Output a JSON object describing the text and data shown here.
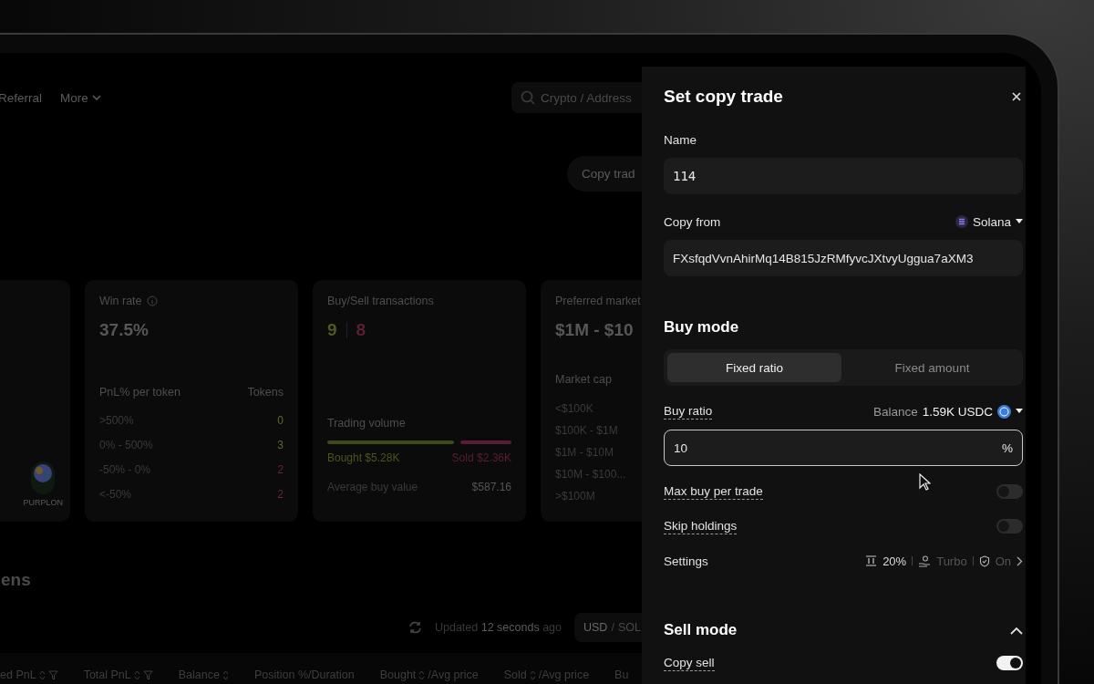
{
  "nav": {
    "items": [
      {
        "label": "Referral",
        "has_menu": false
      },
      {
        "label": "More",
        "has_menu": true
      }
    ],
    "search": {
      "placeholder": "Crypto / Address"
    }
  },
  "copy_trade_button": "Copy trad",
  "token_card": {
    "token": "PURPLON"
  },
  "win_rate_card": {
    "title": "Win rate",
    "value": "37.5%",
    "header": [
      "PnL% per token",
      "Tokens"
    ],
    "rows": [
      {
        "range": ">500%",
        "count": "0",
        "color": "#5c6b2a"
      },
      {
        "range": "0% - 500%",
        "count": "3",
        "color": "#5c6b2a"
      },
      {
        "range": "-50% - 0%",
        "count": "2",
        "color": "#6b2438"
      },
      {
        "range": "<-50%",
        "count": "2",
        "color": "#6b2438"
      }
    ]
  },
  "transactions_card": {
    "title": "Buy/Sell transactions",
    "buys": "9",
    "sells": "8",
    "volume_label": "Trading volume",
    "level": 0.69,
    "bought": "Bought $5.28K",
    "sold": "Sold $2.36K",
    "average_label": "Average buy value",
    "average": "$587.16"
  },
  "market_card": {
    "title": "Preferred market",
    "value": "$1M - $10",
    "subtitle": "Market cap",
    "rows": [
      "<$100K",
      "$100K - $1M",
      "$1M - $10M",
      "$10M - $100...",
      ">$100M"
    ]
  },
  "tokens": {
    "heading": "ens",
    "updated": "Updated **12 seconds** ago",
    "currencies": [
      {
        "label": "USD",
        "selected": true
      },
      {
        "label": "SOL",
        "selected": false
      }
    ],
    "separator": "/",
    "columns": [
      {
        "label": "ed PnL",
        "sort": true,
        "filter": true
      },
      {
        "label": "Total PnL",
        "sort": true,
        "filter": true
      },
      {
        "label": "Balance",
        "sort": true,
        "filter": false
      },
      {
        "label": "Position %/Duration",
        "sort": false,
        "filter": false
      },
      {
        "label": "Bought",
        "sort": true,
        "filter": false,
        "suffix": "/Avg price"
      },
      {
        "label": "Sold",
        "sort": true,
        "filter": false,
        "suffix": "/Avg price"
      },
      {
        "label": "Bu",
        "sort": false,
        "filter": false
      }
    ]
  },
  "panel": {
    "title": "Set copy trade",
    "name": {
      "label": "Name",
      "value": "114"
    },
    "copy_from": {
      "label": "Copy from",
      "chain": "Solana",
      "value": "FXsfqdVvnAhirMq14B815JzRMfyvcJXtvyUggua7aXM3"
    },
    "buy_mode": {
      "title": "Buy mode",
      "tabs": [
        {
          "label": "Fixed ratio",
          "selected": true
        },
        {
          "label": "Fixed amount",
          "selected": false
        }
      ],
      "ratio": {
        "label": "Buy ratio",
        "balance_label": "Balance",
        "balance": "1.59K USDC",
        "value": "10",
        "unit": "%"
      },
      "toggles": [
        {
          "label": "Max buy per trade",
          "on": false
        },
        {
          "label": "Skip holdings",
          "on": false
        }
      ],
      "settings": {
        "label": "Settings",
        "slippage": "20%",
        "gas": "Turbo",
        "protection": "On"
      }
    },
    "sell_mode": {
      "title": "Sell mode",
      "expanded": true,
      "toggles": [
        {
          "label": "Copy sell",
          "on": true
        }
      ]
    }
  }
}
